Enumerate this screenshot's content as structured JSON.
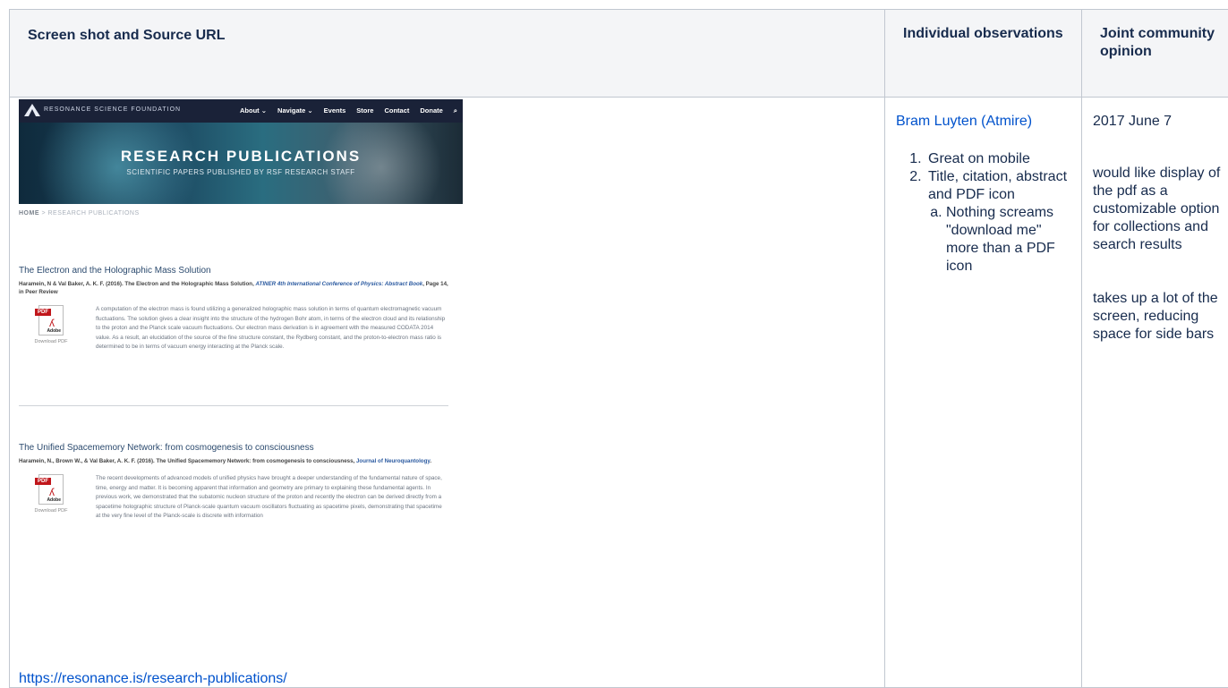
{
  "table": {
    "headers": [
      "Screen shot and Source URL",
      "Individual observations",
      "Joint community opinion"
    ]
  },
  "screenshot": {
    "brand": "RESONANCE SCIENCE FOUNDATION",
    "menu": [
      "About ⌄",
      "Navigate ⌄",
      "Events",
      "Store",
      "Contact",
      "Donate",
      "⌕"
    ],
    "hero_title": "RESEARCH PUBLICATIONS",
    "hero_subtitle": "SCIENTIFIC PAPERS PUBLISHED BY RSF RESEARCH STAFF",
    "breadcrumb_home": "HOME",
    "breadcrumb_rest": " > RESEARCH PUBLICATIONS",
    "download_label": "Download PDF",
    "pdf_tag": "PDF",
    "adobe_label": "Adobe",
    "publications": [
      {
        "title": "The Electron and the Holographic Mass Solution",
        "cite_main": "Haramein, N & Val Baker, A. K. F. (2016). The Electron and the Holographic Mass Solution, ",
        "cite_venue": "ATINER 4th International Conference of Physics: Abstract Book",
        "cite_tail": ", Page 14, in Peer Review",
        "abstract": "A computation of the electron mass is found utilizing a generalized holographic mass solution in terms of quantum electromagnetic vacuum fluctuations. The solution gives a clear insight into the structure of the hydrogen Bohr atom, in terms of the electron cloud and its relationship to the proton and the Planck scale vacuum fluctuations. Our electron mass derivation is in agreement with the measured CODATA 2014 value. As a result, an elucidation of the source of the fine structure constant, the Rydberg constant, and the proton-to-electron mass ratio is determined to be in terms of vacuum energy interacting at the Planck scale."
      },
      {
        "title": "The Unified Spacememory Network: from cosmogenesis to consciousness",
        "cite_main": "Haramein, N., Brown W., & Val Baker, A. K. F. (2016). The Unified Spacememory Network: from cosmogenesis to consciousness, ",
        "cite_venue": "Journal of Neuroquantology",
        "cite_tail": ".",
        "abstract": "The recent developments of advanced models of unified physics have brought a deeper understanding of the fundamental nature of space, time, energy and matter. It is becoming apparent that information and geometry are primary to explaining these fundamental agents. In previous work, we demonstrated that the subatomic nucleon structure of the proton and recently the electron can be derived directly from a spacetime holographic structure of Planck-scale quantum vacuum oscillators fluctuating as spacetime pixels, demonstrating that spacetime at the very fine level of the Planck-scale is discrete with information"
      }
    ]
  },
  "source_url": "https://resonance.is/research-publications/",
  "observations": {
    "author": "Bram Luyten (Atmire)",
    "items": [
      "Great on mobile",
      "Title, citation, abstract and PDF icon"
    ],
    "subitems": [
      "Nothing screams \"download me\" more than a PDF icon"
    ]
  },
  "opinion": {
    "date": "2017 June 7",
    "para1": "would like display of the pdf as a customizable option for collections and search results",
    "para2": "takes up a lot of the screen, reducing space for side bars"
  },
  "colors": {
    "link": "#0052cc",
    "header_bg": "#f4f5f7",
    "border": "#c1c7d0",
    "pdf_red": "#c0161b"
  }
}
